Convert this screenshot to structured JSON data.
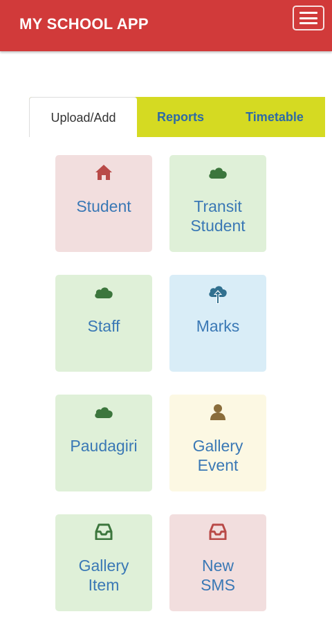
{
  "navbar": {
    "title": "MY SCHOOL APP",
    "bg_color": "#d13a3a",
    "menu_icon": "hamburger-icon"
  },
  "tabs": [
    {
      "label": "Upload/Add",
      "active": true
    },
    {
      "label": "Reports",
      "active": false
    },
    {
      "label": "Timetable",
      "active": false
    }
  ],
  "tabs_color": "#d5da22",
  "tiles": [
    {
      "label": "Student",
      "icon": "home-icon",
      "color": "#f2dede"
    },
    {
      "label": "Transit\nStudent",
      "icon": "cloud-icon",
      "color": "#dff0d8"
    },
    {
      "label": "Staff",
      "icon": "cloud-icon",
      "color": "#dff0d8"
    },
    {
      "label": "Marks",
      "icon": "cloud-upload-icon",
      "color": "#d9edf7"
    },
    {
      "label": "Paudagiri",
      "icon": "cloud-icon",
      "color": "#dff0d8"
    },
    {
      "label": "Gallery\nEvent",
      "icon": "user-icon",
      "color": "#fcf8e3"
    },
    {
      "label": "Gallery\nItem",
      "icon": "inbox-icon",
      "color": "#dff0d8"
    },
    {
      "label": "New\nSMS",
      "icon": "inbox-icon",
      "color": "#f2dede"
    }
  ]
}
